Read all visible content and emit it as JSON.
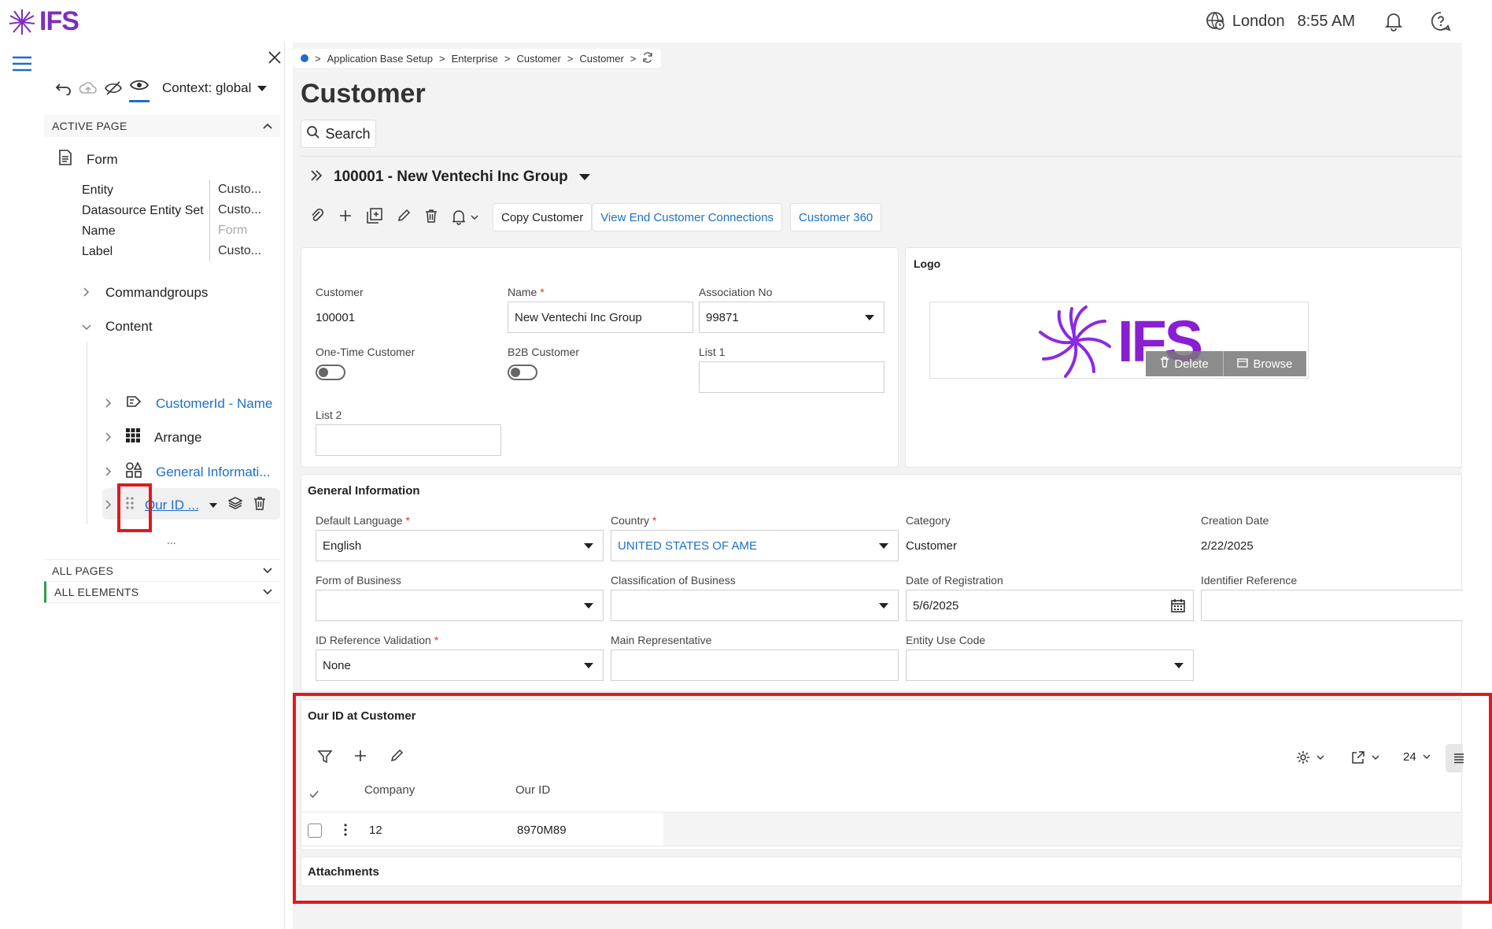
{
  "topbar": {
    "brand": "IFS",
    "location": "London",
    "time": "8:55 AM"
  },
  "panel": {
    "context_label": "Context: global",
    "active_page": "ACTIVE PAGE",
    "form_label": "Form",
    "props": [
      {
        "key": "Entity",
        "value": "Custo..."
      },
      {
        "key": "Datasource Entity Set",
        "value": "Custo..."
      },
      {
        "key": "Name",
        "value": "Form"
      },
      {
        "key": "Label",
        "value": "Custo..."
      }
    ],
    "commandgroups": "Commandgroups",
    "content": "Content",
    "items": [
      {
        "label": "CustomerId - Name"
      },
      {
        "label": "Arrange"
      },
      {
        "label": "General Informati..."
      },
      {
        "label": "Our ID ..."
      }
    ],
    "more": "...",
    "all_pages": "ALL PAGES",
    "all_elements": "ALL ELEMENTS"
  },
  "breadcrumb": [
    "Application Base Setup",
    "Enterprise",
    "Customer",
    "Customer"
  ],
  "page_title": "Customer",
  "search_label": "Search",
  "record_title": "100001 - New Ventechi Inc Group",
  "commands": {
    "copy": "Copy Customer",
    "view_end": "View End Customer Connections",
    "c360": "Customer 360"
  },
  "header_form": {
    "customer_label": "Customer",
    "customer_value": "100001",
    "name_label": "Name",
    "name_value": "New Ventechi Inc Group",
    "assoc_label": "Association No",
    "assoc_value": "99871",
    "onetime_label": "One-Time Customer",
    "b2b_label": "B2B Customer",
    "list1_label": "List 1",
    "list2_label": "List 2",
    "logo_label": "Logo",
    "logo_text": "IFS",
    "delete_label": "Delete",
    "browse_label": "Browse"
  },
  "general": {
    "title": "General Information",
    "default_language_label": "Default Language",
    "default_language_value": "English",
    "country_label": "Country",
    "country_value": "UNITED STATES OF AME",
    "category_label": "Category",
    "category_value": "Customer",
    "creation_date_label": "Creation Date",
    "creation_date_value": "2/22/2025",
    "form_business_label": "Form of Business",
    "class_business_label": "Classification of Business",
    "date_reg_label": "Date of Registration",
    "date_reg_value": "5/6/2025",
    "identifier_ref_label": "Identifier Reference",
    "id_ref_validation_label": "ID Reference Validation",
    "id_ref_validation_value": "None",
    "main_rep_label": "Main Representative",
    "entity_use_label": "Entity Use Code"
  },
  "ourid": {
    "title": "Our ID at Customer",
    "page_size": "24",
    "columns": [
      "Company",
      "Our ID"
    ],
    "rows": [
      {
        "company": "12",
        "our_id": "8970M89"
      }
    ]
  },
  "attachments": {
    "title": "Attachments"
  },
  "colors": {
    "accent": "#7b2fbe",
    "link": "#1d6fc9",
    "highlight": "#e0191e"
  }
}
